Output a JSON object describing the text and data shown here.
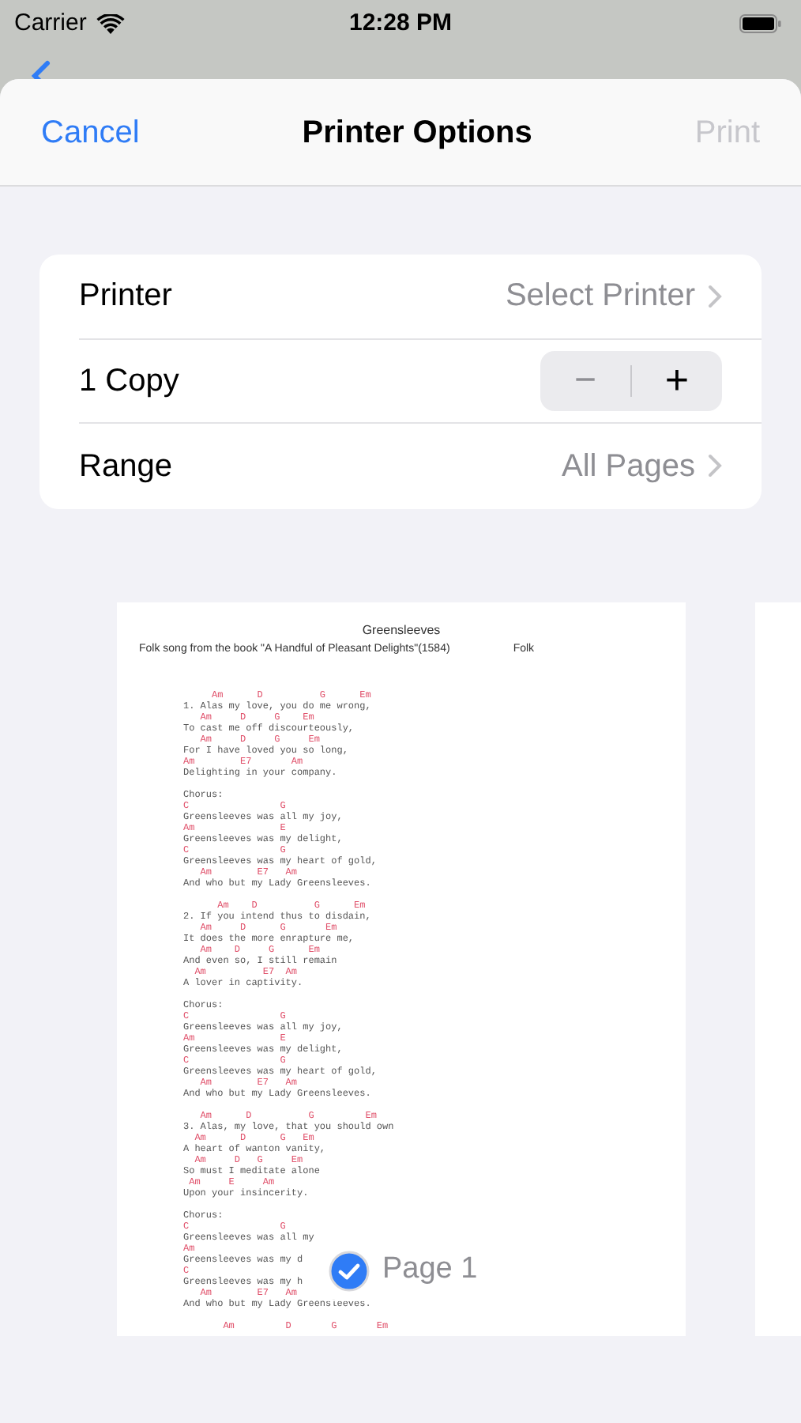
{
  "status_bar": {
    "carrier": "Carrier",
    "time": "12:28 PM"
  },
  "nav": {
    "cancel": "Cancel",
    "title": "Printer Options",
    "print": "Print",
    "print_disabled": true
  },
  "options": [
    {
      "kind": "link",
      "label": "Printer",
      "value": "Select Printer"
    },
    {
      "kind": "stepper",
      "label": "1 Copy",
      "minus": "−",
      "plus": "+"
    },
    {
      "kind": "link",
      "label": "Range",
      "value": "All Pages"
    }
  ],
  "preview": {
    "title": "Greensleeves",
    "subtitle": "Folk song from the book \"A Handful of Pleasant Delights\"(1584)",
    "genre": "Folk",
    "lines": [
      {
        "kind": "chord",
        "text": "     Am      D          G      Em"
      },
      {
        "kind": "lyric",
        "text": "1. Alas my love, you do me wrong,"
      },
      {
        "kind": "chord",
        "text": "   Am     D     G    Em"
      },
      {
        "kind": "lyric",
        "text": "To cast me off discourteously,"
      },
      {
        "kind": "chord",
        "text": "   Am     D     G     Em"
      },
      {
        "kind": "lyric",
        "text": "For I have loved you so long,"
      },
      {
        "kind": "chord",
        "text": "Am        E7       Am"
      },
      {
        "kind": "lyric",
        "text": "Delighting in your company."
      },
      {
        "kind": "gap"
      },
      {
        "kind": "lyric",
        "text": "Chorus:"
      },
      {
        "kind": "chord",
        "text": "C                G"
      },
      {
        "kind": "lyric",
        "text": "Greensleeves was all my joy,"
      },
      {
        "kind": "chord",
        "text": "Am               E"
      },
      {
        "kind": "lyric",
        "text": "Greensleeves was my delight,"
      },
      {
        "kind": "chord",
        "text": "C                G"
      },
      {
        "kind": "lyric",
        "text": "Greensleeves was my heart of gold,"
      },
      {
        "kind": "chord",
        "text": "   Am        E7   Am"
      },
      {
        "kind": "lyric",
        "text": "And who but my Lady Greensleeves."
      },
      {
        "kind": "gap"
      },
      {
        "kind": "chord",
        "text": "      Am    D          G      Em"
      },
      {
        "kind": "lyric",
        "text": "2. If you intend thus to disdain,"
      },
      {
        "kind": "chord",
        "text": "   Am     D      G       Em"
      },
      {
        "kind": "lyric",
        "text": "It does the more enrapture me,"
      },
      {
        "kind": "chord",
        "text": "   Am    D     G      Em"
      },
      {
        "kind": "lyric",
        "text": "And even so, I still remain"
      },
      {
        "kind": "chord",
        "text": "  Am          E7  Am"
      },
      {
        "kind": "lyric",
        "text": "A lover in captivity."
      },
      {
        "kind": "gap"
      },
      {
        "kind": "lyric",
        "text": "Chorus:"
      },
      {
        "kind": "chord",
        "text": "C                G"
      },
      {
        "kind": "lyric",
        "text": "Greensleeves was all my joy,"
      },
      {
        "kind": "chord",
        "text": "Am               E"
      },
      {
        "kind": "lyric",
        "text": "Greensleeves was my delight,"
      },
      {
        "kind": "chord",
        "text": "C                G"
      },
      {
        "kind": "lyric",
        "text": "Greensleeves was my heart of gold,"
      },
      {
        "kind": "chord",
        "text": "   Am        E7   Am"
      },
      {
        "kind": "lyric",
        "text": "And who but my Lady Greensleeves."
      },
      {
        "kind": "gap"
      },
      {
        "kind": "chord",
        "text": "   Am      D          G         Em"
      },
      {
        "kind": "lyric",
        "text": "3. Alas, my love, that you should own"
      },
      {
        "kind": "chord",
        "text": "  Am      D      G   Em"
      },
      {
        "kind": "lyric",
        "text": "A heart of wanton vanity,"
      },
      {
        "kind": "chord",
        "text": "  Am     D   G     Em"
      },
      {
        "kind": "lyric",
        "text": "So must I meditate alone"
      },
      {
        "kind": "chord",
        "text": " Am     E     Am"
      },
      {
        "kind": "lyric",
        "text": "Upon your insincerity."
      },
      {
        "kind": "gap"
      },
      {
        "kind": "lyric",
        "text": "Chorus:"
      },
      {
        "kind": "chord",
        "text": "C                G"
      },
      {
        "kind": "lyric",
        "text": "Greensleeves was all my"
      },
      {
        "kind": "chord",
        "text": "Am"
      },
      {
        "kind": "lyric",
        "text": "Greensleeves was my d"
      },
      {
        "kind": "chord",
        "text": "C"
      },
      {
        "kind": "lyric",
        "text": "Greensleeves was my h"
      },
      {
        "kind": "chord",
        "text": "   Am        E7   Am"
      },
      {
        "kind": "lyric",
        "text": "And who but my Lady Greensleeves."
      },
      {
        "kind": "gap"
      },
      {
        "kind": "chord",
        "text": "       Am         D       G       Em"
      }
    ],
    "page_badge": {
      "label": "Page 1",
      "selected": true
    }
  }
}
